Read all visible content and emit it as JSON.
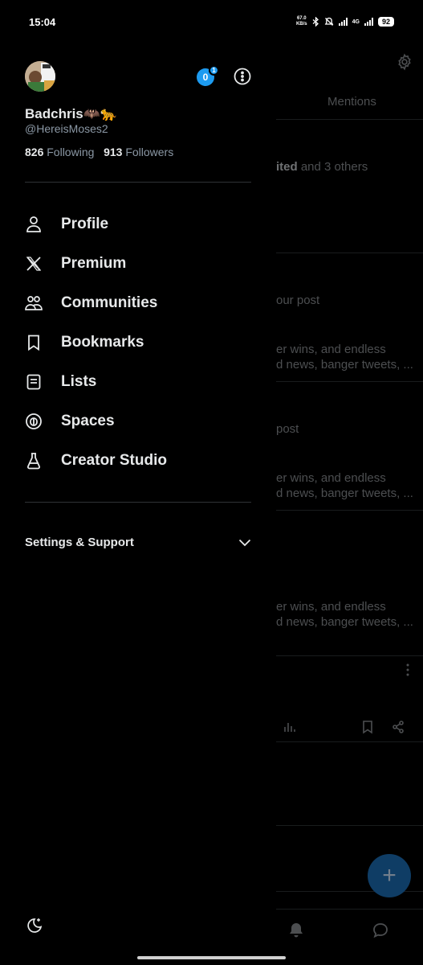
{
  "status_bar": {
    "time": "15:04",
    "net_speed_value": "67.0",
    "net_speed_unit": "KB/s",
    "network": "4G",
    "battery": "92"
  },
  "background": {
    "tab_mentions": "Mentions",
    "notif_1_bold": "ited",
    "notif_1_rest": " and 3 others",
    "notif_2": "our post",
    "notif_2_snip_1": "er wins, and endless",
    "notif_2_snip_2": "d news, banger tweets, ...",
    "notif_3": "post",
    "notif_3_snip_1": "er wins, and endless",
    "notif_3_snip_2": "d news, banger tweets, ...",
    "notif_4_snip_1": "er wins, and endless",
    "notif_4_snip_2": "d news, banger tweets, ...",
    "fab_label": "+"
  },
  "profile": {
    "name": "Badchris🦇🐆",
    "handle": "@HereisMoses2",
    "following_count": "826",
    "following_label": "Following",
    "followers_count": "913",
    "followers_label": "Followers",
    "account_badge_count": "0",
    "account_badge_dot": "1"
  },
  "menu": {
    "items": [
      {
        "label": "Profile",
        "icon": "person-icon"
      },
      {
        "label": "Premium",
        "icon": "x-logo-icon"
      },
      {
        "label": "Communities",
        "icon": "communities-icon"
      },
      {
        "label": "Bookmarks",
        "icon": "bookmark-icon"
      },
      {
        "label": "Lists",
        "icon": "list-icon"
      },
      {
        "label": "Spaces",
        "icon": "spaces-icon"
      },
      {
        "label": "Creator Studio",
        "icon": "creator-studio-icon"
      }
    ]
  },
  "settings_support": {
    "label": "Settings & Support"
  },
  "colors": {
    "accent": "#1d9bf0",
    "background": "#000000",
    "divider": "#2f3336",
    "text_primary": "#e7e9ea",
    "text_secondary": "#8b98a5"
  }
}
